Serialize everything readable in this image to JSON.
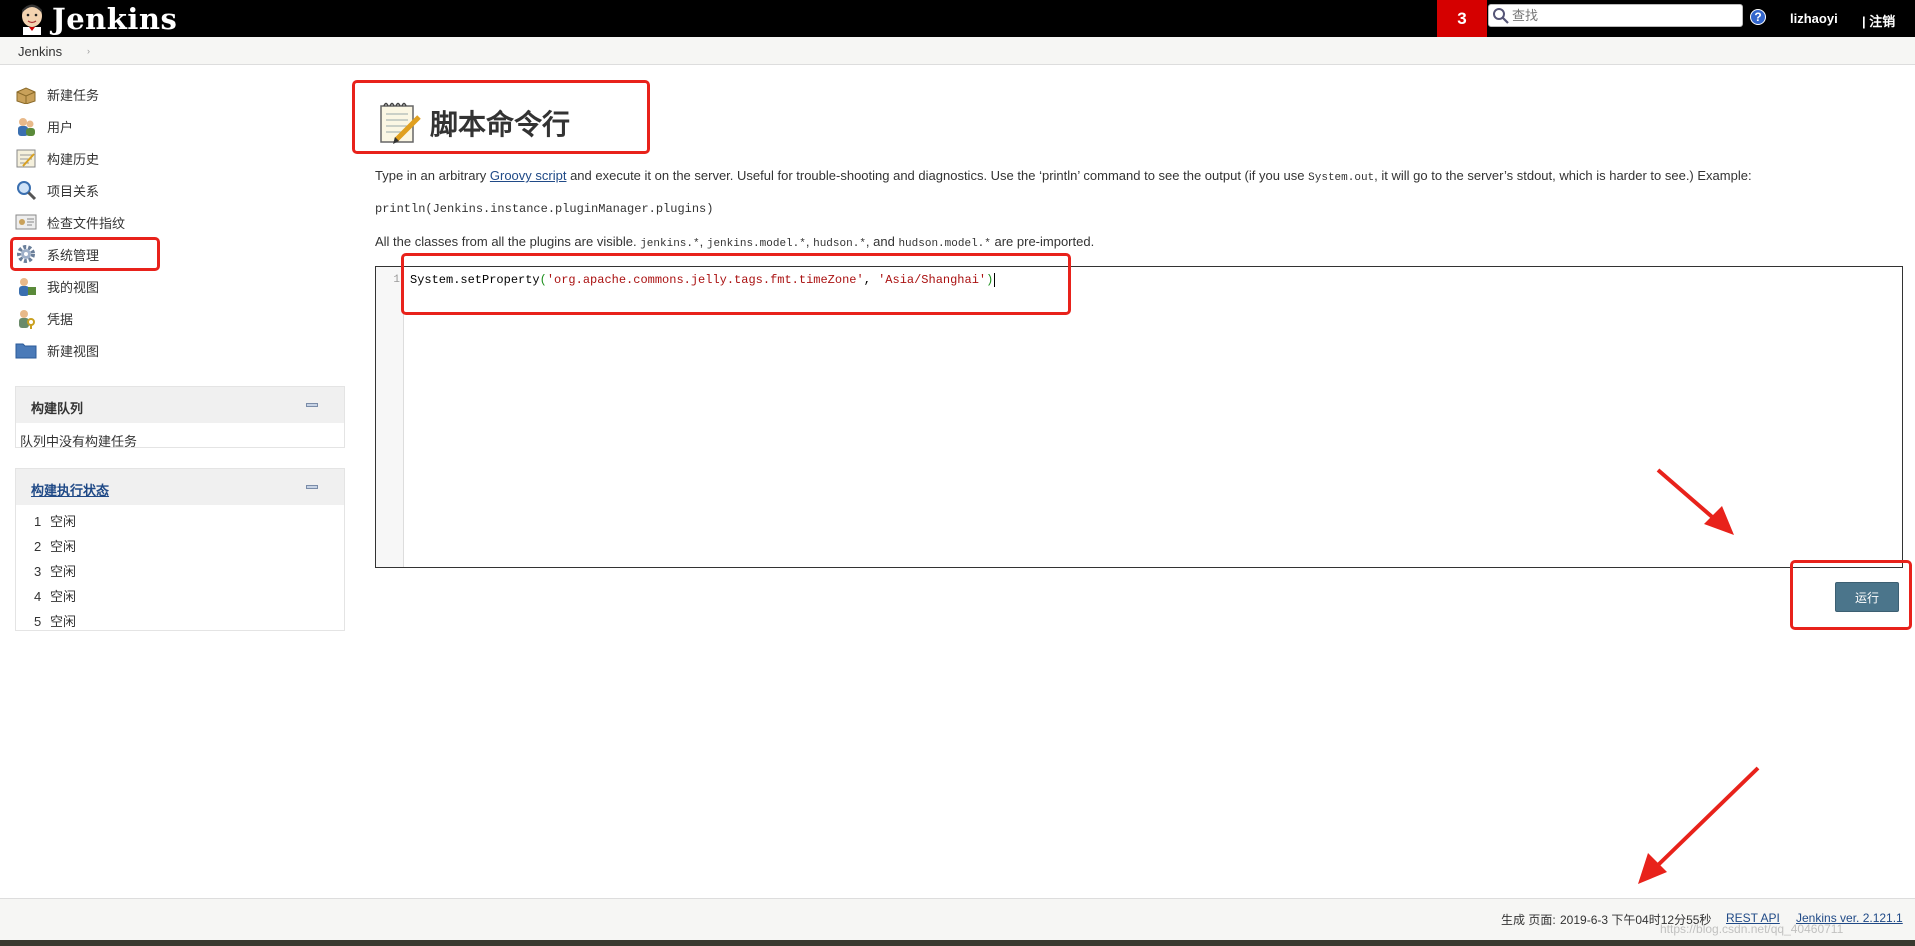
{
  "header": {
    "logo_text": "Jenkins",
    "notification_count": "3",
    "search_placeholder": "查找",
    "help_label": "?",
    "username": "lizhaoyi",
    "logout_label": "| 注销"
  },
  "breadcrumb": {
    "home": "Jenkins",
    "separator": "›"
  },
  "sidebar": {
    "tasks": [
      {
        "label": "新建任务",
        "icon": "new-package-icon"
      },
      {
        "label": "用户",
        "icon": "people-icon"
      },
      {
        "label": "构建历史",
        "icon": "notepad-icon"
      },
      {
        "label": "项目关系",
        "icon": "magnifier-icon"
      },
      {
        "label": "检查文件指纹",
        "icon": "fingerprint-icon"
      },
      {
        "label": "系统管理",
        "icon": "gear-icon"
      },
      {
        "label": "我的视图",
        "icon": "user-view-icon"
      },
      {
        "label": "凭据",
        "icon": "credentials-icon"
      },
      {
        "label": "新建视图",
        "icon": "folder-icon"
      }
    ],
    "build_queue": {
      "title": "构建队列",
      "empty_text": "队列中没有构建任务"
    },
    "executors": {
      "title": "构建执行状态",
      "rows": [
        {
          "num": "1",
          "status": "空闲"
        },
        {
          "num": "2",
          "status": "空闲"
        },
        {
          "num": "3",
          "status": "空闲"
        },
        {
          "num": "4",
          "status": "空闲"
        },
        {
          "num": "5",
          "status": "空闲"
        }
      ]
    }
  },
  "main": {
    "title": "脚本命令行",
    "desc1_before": "Type in an arbitrary ",
    "desc1_link": "Groovy script",
    "desc1_mid": " and execute it on the server. Useful for trouble-shooting and diagnostics. Use the ‘println’ command to see the output (if you use ",
    "desc1_code": "System.out",
    "desc1_after": ", it will go to the server’s stdout, which is harder to see.) Example:",
    "example": "println(Jenkins.instance.pluginManager.plugins)",
    "desc2_before": "All the classes from all the plugins are visible. ",
    "desc2_c1": "jenkins.*",
    "desc2_s1": ", ",
    "desc2_c2": "jenkins.model.*",
    "desc2_s2": ", ",
    "desc2_c3": "hudson.*",
    "desc2_s3": ", and ",
    "desc2_c4": "hudson.model.*",
    "desc2_after": " are pre-imported.",
    "editor": {
      "line_number": "1",
      "code_call": "System.setProperty",
      "code_paren_open": "(",
      "code_arg1": "'org.apache.commons.jelly.tags.fmt.timeZone'",
      "code_comma": ", ",
      "code_arg2": "'Asia/Shanghai'",
      "code_paren_close": ")"
    },
    "run_label": "运行"
  },
  "footer": {
    "generated_label": "生成 页面:",
    "timestamp": "2019-6-3 下午04时12分55秒",
    "rest_api": "REST API",
    "version": "Jenkins ver. 2.121.1"
  },
  "watermark": "https://blog.csdn.net/qq_40460711",
  "colors": {
    "header_bg": "#000000",
    "notification_bg": "#d50000",
    "annotation_red": "#e8221b",
    "run_button": "#4b758b",
    "link": "#204a87"
  }
}
